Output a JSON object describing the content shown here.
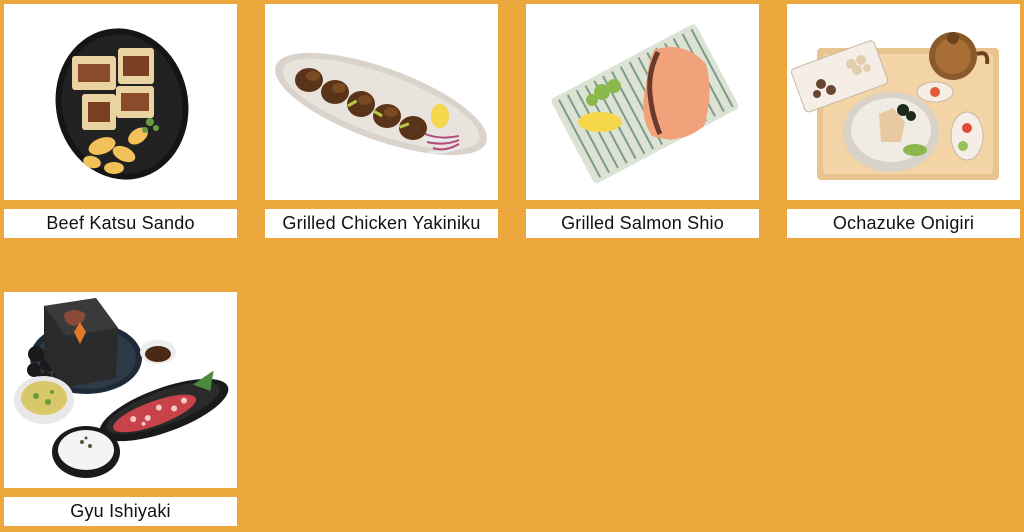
{
  "menu": {
    "items": [
      {
        "name": "Beef Katsu Sando",
        "icon": "beef-katsu-sando-photo"
      },
      {
        "name": "Grilled Chicken Yakiniku",
        "icon": "grilled-chicken-yakiniku-photo"
      },
      {
        "name": "Grilled Salmon Shio",
        "icon": "grilled-salmon-shio-photo"
      },
      {
        "name": "Ochazuke Onigiri",
        "icon": "ochazuke-onigiri-photo"
      },
      {
        "name": "Gyu Ishiyaki",
        "icon": "gyu-ishiyaki-photo"
      }
    ]
  },
  "colors": {
    "background": "#EDA83D",
    "card": "#FFFFFF",
    "text": "#111111"
  }
}
